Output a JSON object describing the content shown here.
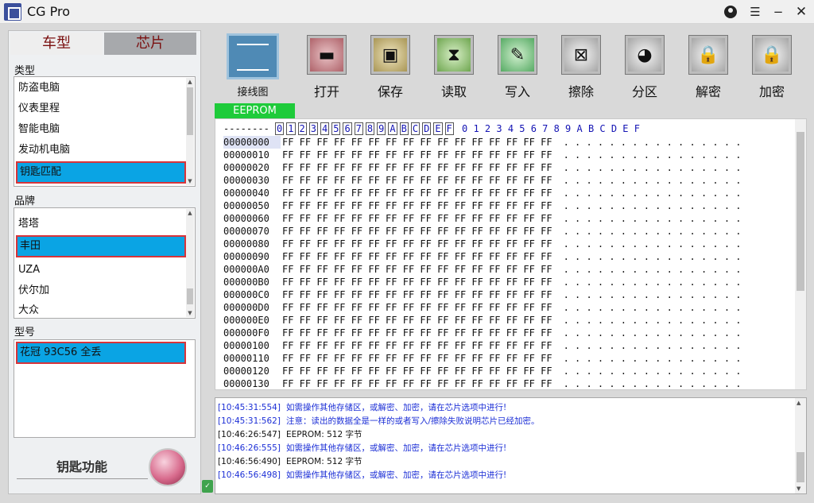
{
  "window": {
    "title": "CG Pro"
  },
  "tabs": {
    "car": "车型",
    "chip": "芯片"
  },
  "type_section": {
    "label": "类型",
    "items": [
      "防盗电脑",
      "仪表里程",
      "智能电脑",
      "发动机电脑"
    ],
    "selected": "钥匙匹配"
  },
  "brand_section": {
    "label": "品牌",
    "items_before": [
      "塔塔"
    ],
    "selected": "丰田",
    "items_after": [
      "UZA",
      "伏尔加",
      "大众"
    ]
  },
  "model_section": {
    "label": "型号",
    "selected": "花冠 93C56 全丢"
  },
  "key_function": {
    "label": "钥匙功能"
  },
  "toolbar": {
    "wiring": "接线图",
    "open": "打开",
    "save": "保存",
    "read": "读取",
    "write": "写入",
    "erase": "擦除",
    "partition": "分区",
    "decrypt": "解密",
    "encrypt": "加密"
  },
  "eeprom_tab": "EEPROM",
  "hex": {
    "header_dashes": "--------",
    "columns": [
      "0",
      "1",
      "2",
      "3",
      "4",
      "5",
      "6",
      "7",
      "8",
      "9",
      "A",
      "B",
      "C",
      "D",
      "E",
      "F"
    ],
    "ascii_header": "0 1 2 3 4 5 6 7 8 9 A B C D E F",
    "byte_value": "FF FF FF FF FF FF FF FF FF FF FF FF FF FF FF FF",
    "ascii_value": ". . . . . . . . . . . . . . . .",
    "addresses": [
      "00000000",
      "00000010",
      "00000020",
      "00000030",
      "00000040",
      "00000050",
      "00000060",
      "00000070",
      "00000080",
      "00000090",
      "000000A0",
      "000000B0",
      "000000C0",
      "000000D0",
      "000000E0",
      "000000F0",
      "00000100",
      "00000110",
      "00000120",
      "00000130"
    ]
  },
  "log": [
    {
      "ts": "[10:45:31:554]",
      "msg": "如需操作其他存储区，或解密、加密，请在芯片选项中进行!",
      "color": "blue"
    },
    {
      "ts": "[10:45:31:562]",
      "msg": "注意：读出的数据全是一样的或者写入/擦除失败说明芯片已经加密。",
      "color": "blue"
    },
    {
      "ts": "[10:46:26:547]",
      "msg": "EEPROM:   512   字节",
      "color": "black"
    },
    {
      "ts": "[10:46:26:555]",
      "msg": "如需操作其他存储区，或解密、加密，请在芯片选项中进行!",
      "color": "blue"
    },
    {
      "ts": "[10:46:56:490]",
      "msg": "EEPROM:   512   字节",
      "color": "black"
    },
    {
      "ts": "[10:46:56:498]",
      "msg": "如需操作其他存储区，或解密、加密，请在芯片选项中进行!",
      "color": "blue"
    }
  ]
}
